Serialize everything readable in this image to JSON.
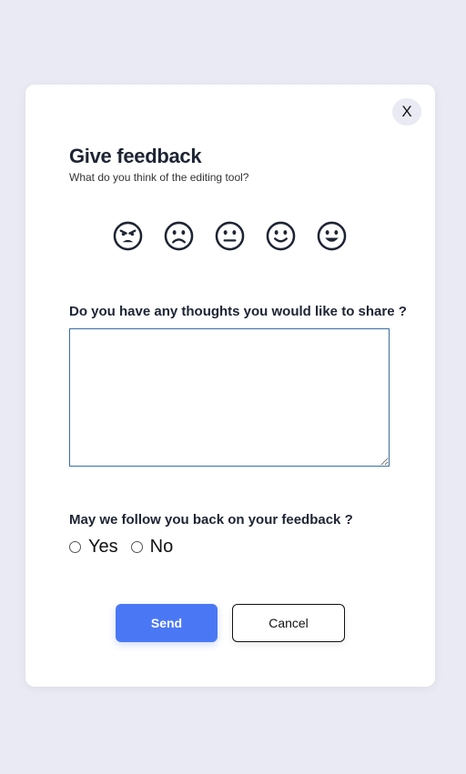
{
  "dialog": {
    "close_label": "X",
    "title": "Give feedback",
    "subtitle": "What do you think of the editing tool?"
  },
  "rating": {
    "options": [
      {
        "icon": "angry-face-icon"
      },
      {
        "icon": "frowning-face-icon"
      },
      {
        "icon": "neutral-face-icon"
      },
      {
        "icon": "slightly-smiling-face-icon"
      },
      {
        "icon": "grinning-face-icon"
      }
    ]
  },
  "thoughts": {
    "question": "Do you have any thoughts you would like to share ?",
    "value": ""
  },
  "follow_up": {
    "question": "May we follow you back on your feedback ?",
    "options": [
      {
        "label": "Yes",
        "checked": false
      },
      {
        "label": "No",
        "checked": false
      }
    ]
  },
  "actions": {
    "send_label": "Send",
    "cancel_label": "Cancel"
  },
  "colors": {
    "background": "#e9eaf3",
    "accent": "#4a78f5",
    "text": "#1d2433",
    "textarea_border": "#3a6ea5"
  }
}
